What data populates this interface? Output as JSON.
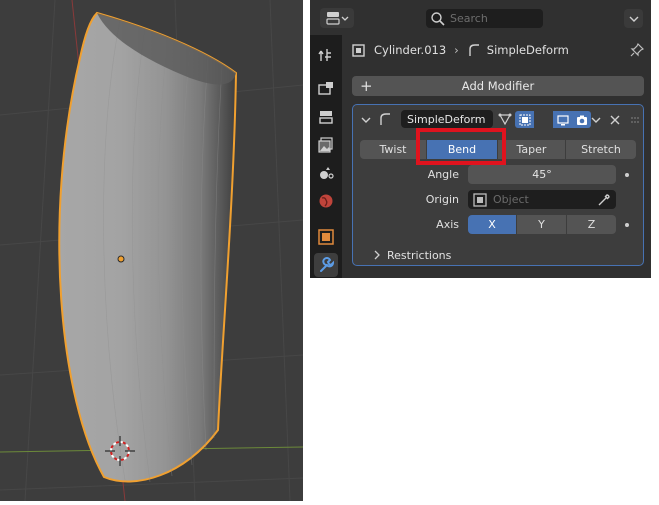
{
  "header": {
    "search_placeholder": "Search"
  },
  "breadcrumb": {
    "object": "Cylinder.013",
    "modifier": "SimpleDeform"
  },
  "add_modifier_label": "Add Modifier",
  "modifier": {
    "name": "SimpleDeform",
    "modes": [
      "Twist",
      "Bend",
      "Taper",
      "Stretch"
    ],
    "active_mode": "Bend",
    "angle_label": "Angle",
    "angle_value": "45°",
    "origin_label": "Origin",
    "origin_placeholder": "Object",
    "axis_label": "Axis",
    "axes": [
      "X",
      "Y",
      "Z"
    ],
    "active_axis": "X",
    "restrictions_label": "Restrictions"
  },
  "colors": {
    "accent": "#4772b3",
    "highlight_box": "#e0131e",
    "selection_outline": "#f0a030"
  },
  "icons": [
    "editor-type-icon",
    "search-icon",
    "chevron-down-icon",
    "tool-icon",
    "render-icon",
    "output-icon",
    "view-layer-icon",
    "scene-icon",
    "world-icon",
    "object-icon",
    "modifier-wrench-icon",
    "mesh-object-icon",
    "modifier-icon",
    "pin-icon",
    "plus-icon",
    "edit-mode-icon",
    "cage-icon",
    "realtime-icon",
    "render-camera-icon",
    "close-icon",
    "drag-handle-icon",
    "eyedropper-icon",
    "expand-chevron-icon"
  ]
}
